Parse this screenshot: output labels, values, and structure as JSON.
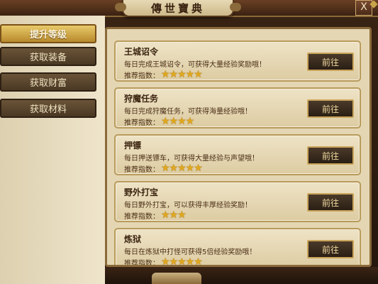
{
  "window": {
    "title": "傳世寶典",
    "close_label": "X"
  },
  "nav": {
    "items": [
      {
        "label": "提升等级",
        "active": true
      },
      {
        "label": "获取装备",
        "active": false
      },
      {
        "label": "获取财富",
        "active": false
      },
      {
        "label": "获取材料",
        "active": false
      }
    ]
  },
  "rating_label": "推荐指数：",
  "go_label": "前往",
  "entries": [
    {
      "title": "王城诏令",
      "desc": "每日完成王城诏令，可获得大量经验奖励哦！",
      "stars": "★★★★★",
      "star_count": 5
    },
    {
      "title": "狩魔任务",
      "desc": "每日完成狩魔任务，可获得海量经验哦！",
      "stars": "★★★★",
      "star_count": 4
    },
    {
      "title": "押镖",
      "desc": "每日押送镖车，可获得大量经验与声望哦！",
      "stars": "★★★★★",
      "star_count": 5
    },
    {
      "title": "野外打宝",
      "desc": "每日野外打宝，可以获得丰厚经验奖励！",
      "stars": "★★★",
      "star_count": 3
    },
    {
      "title": "炼狱",
      "desc": "每日在炼狱中打怪可获得5倍经验奖励哦！",
      "stars": "★★★★★",
      "star_count": 5
    }
  ],
  "colors": {
    "accent_gold": "#c9a45a",
    "star": "#e0a81e",
    "panel_bg": "#e4d6b2"
  }
}
